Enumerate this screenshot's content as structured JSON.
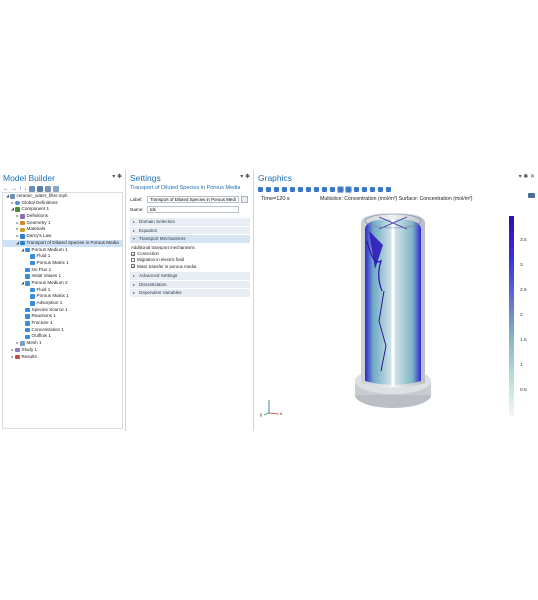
{
  "model_builder": {
    "title": "Model Builder",
    "tree": [
      {
        "label": "ceramic_water_filter.mph",
        "level": 0,
        "icon": "file-icon",
        "arrow": "down"
      },
      {
        "label": "Global Definitions",
        "level": 1,
        "icon": "globe-icon",
        "arrow": "right"
      },
      {
        "label": "Component 1",
        "level": 1,
        "icon": "component-icon",
        "arrow": "down"
      },
      {
        "label": "Definitions",
        "level": 2,
        "icon": "definitions-icon",
        "arrow": "right"
      },
      {
        "label": "Geometry 1",
        "level": 2,
        "icon": "geometry-icon",
        "arrow": "right"
      },
      {
        "label": "Materials",
        "level": 2,
        "icon": "materials-icon",
        "arrow": "right"
      },
      {
        "label": "Darcy's Law",
        "level": 2,
        "icon": "physics-icon",
        "arrow": "right"
      },
      {
        "label": "Transport of Diluted Species in Porous Media",
        "level": 2,
        "icon": "physics-icon",
        "arrow": "down",
        "selected": true
      },
      {
        "label": "Porous Medium 1",
        "level": 3,
        "icon": "domain-icon",
        "arrow": "down"
      },
      {
        "label": "Fluid 1",
        "level": 4,
        "icon": "domain-icon",
        "arrow": ""
      },
      {
        "label": "Porous Matrix 1",
        "level": 4,
        "icon": "domain-icon",
        "arrow": ""
      },
      {
        "label": "No Flux 1",
        "level": 3,
        "icon": "domain-icon",
        "arrow": ""
      },
      {
        "label": "Initial Values 1",
        "level": 3,
        "icon": "domain-icon",
        "arrow": ""
      },
      {
        "label": "Porous Medium 2",
        "level": 3,
        "icon": "domain-icon",
        "arrow": "down"
      },
      {
        "label": "Fluid 1",
        "level": 4,
        "icon": "domain-icon",
        "arrow": ""
      },
      {
        "label": "Porous Matrix 1",
        "level": 4,
        "icon": "domain-icon",
        "arrow": ""
      },
      {
        "label": "Adsorption 1",
        "level": 4,
        "icon": "domain-icon",
        "arrow": ""
      },
      {
        "label": "Species Source 1",
        "level": 3,
        "icon": "domain-icon",
        "arrow": ""
      },
      {
        "label": "Reactions 1",
        "level": 3,
        "icon": "domain-icon",
        "arrow": ""
      },
      {
        "label": "Fracture 1",
        "level": 3,
        "icon": "domain-icon",
        "arrow": ""
      },
      {
        "label": "Concentration 1",
        "level": 3,
        "icon": "domain-icon",
        "arrow": ""
      },
      {
        "label": "Outflow 1",
        "level": 3,
        "icon": "domain-icon",
        "arrow": ""
      },
      {
        "label": "Mesh 1",
        "level": 2,
        "icon": "mesh-icon",
        "arrow": "right"
      },
      {
        "label": "Study 1",
        "level": 1,
        "icon": "study-icon",
        "arrow": "right"
      },
      {
        "label": "Results",
        "level": 1,
        "icon": "results-icon",
        "arrow": "right"
      }
    ]
  },
  "settings": {
    "title": "Settings",
    "subtitle": "Transport of Diluted Species in Porous Media",
    "label_caption": "Label:",
    "label_value": "Transport of Diluted Species in Porous Media",
    "name_caption": "Name:",
    "name_value": "tds",
    "sections": [
      {
        "label": "Domain Selection",
        "open": false
      },
      {
        "label": "Equation",
        "open": false
      },
      {
        "label": "Transport Mechanisms",
        "open": true
      }
    ],
    "mechanisms_heading": "Additional transport mechanisms",
    "mechanisms": [
      {
        "label": "Convection",
        "checked": true
      },
      {
        "label": "Migration in electric field",
        "checked": false
      },
      {
        "label": "Mass transfer in porous media",
        "checked": true
      }
    ],
    "more_sections": [
      {
        "label": "Advanced Settings"
      },
      {
        "label": "Discretization"
      },
      {
        "label": "Dependent Variables"
      }
    ]
  },
  "graphics": {
    "title": "Graphics",
    "time": "Time=120 s",
    "plot_title": "Multislice: Concentration (mol/m³)  Surface: Concentration (mol/m³)",
    "colorbar_ticks": [
      "3.5",
      "3",
      "2.5",
      "2",
      "1.5",
      "1",
      "0.5"
    ],
    "colorbar_top": "#2a0fb0",
    "colorbar_bottom": "#f4f6f7",
    "axes": {
      "x": "x",
      "y": "y",
      "z": "z"
    }
  }
}
